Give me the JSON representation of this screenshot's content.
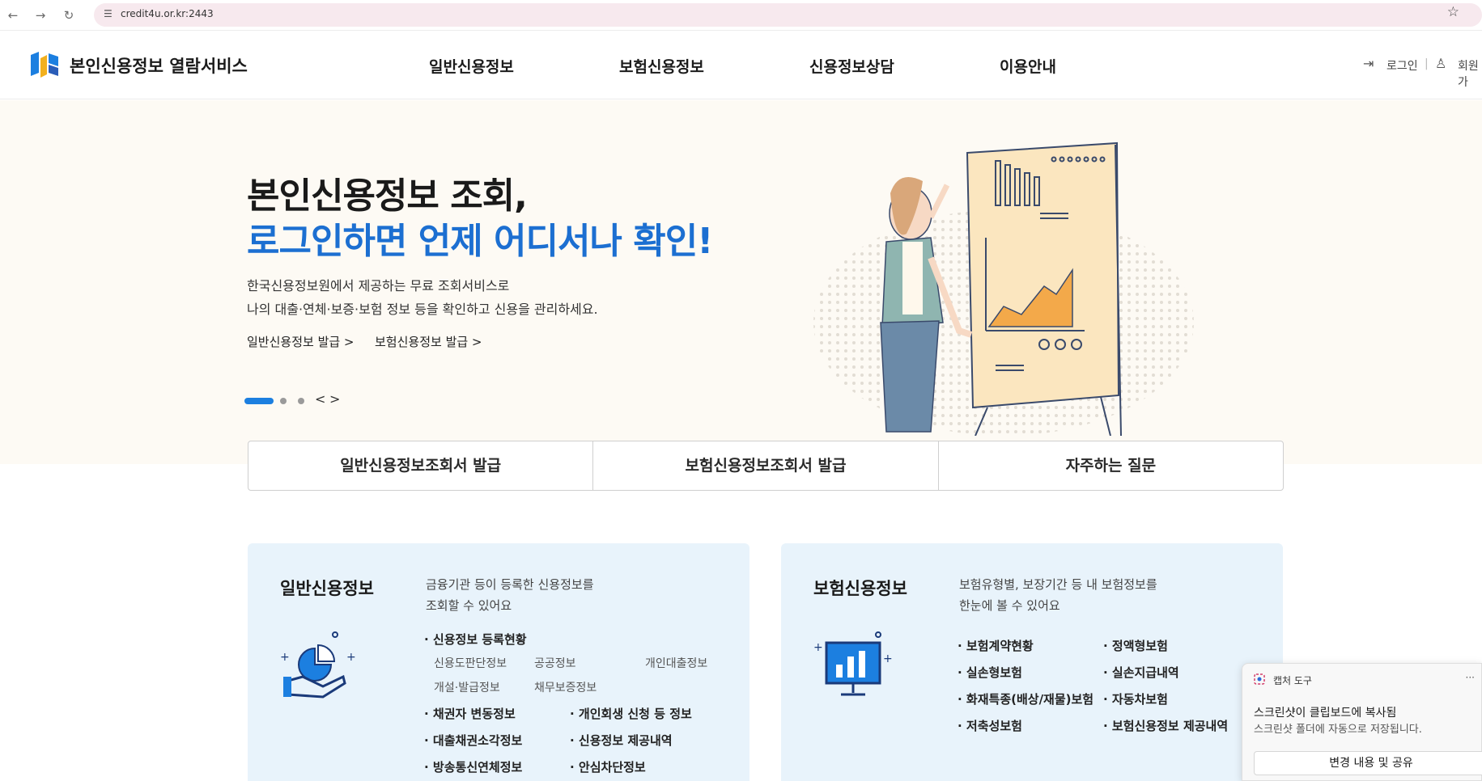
{
  "browser": {
    "url": "credit4u.or.kr:2443",
    "icons": {
      "back": "back-arrow-icon",
      "forward": "forward-arrow-icon",
      "reload": "reload-icon",
      "site_info": "tune-icon",
      "bookmark": "star-icon"
    }
  },
  "header": {
    "title": "본인신용정보 열람서비스",
    "nav": [
      "일반신용정보",
      "보험신용정보",
      "신용정보상담",
      "이용안내"
    ],
    "login": "로그인",
    "separator": "|",
    "signup": "회원가",
    "icons": {
      "login": "login-icon",
      "signup": "user-icon",
      "logo": "cis-logo"
    }
  },
  "hero": {
    "title_line1": "본인신용정보 조회,",
    "title_line2": "로그인하면 언제 어디서나 확인!",
    "desc_line1": "한국신용정보원에서 제공하는 무료 조회서비스로",
    "desc_line2": "나의 대출·연체·보증·보험 정보 등을 확인하고 신용을 관리하세요.",
    "links": [
      "일반신용정보 발급 >",
      "보험신용정보 발급 >"
    ],
    "slider": {
      "active_index": 0,
      "total": 3,
      "prev": "<",
      "next": ">"
    },
    "accent_color": "#1c6fd1"
  },
  "quick_menu": [
    "일반신용정보조회서 발급",
    "보험신용정보조회서 발급",
    "자주하는 질문"
  ],
  "cards": [
    {
      "title": "일반신용정보",
      "desc_line1": "금융기관 등이 등록한 신용정보를",
      "desc_line2": "조회할 수 있어요",
      "icon": "hand-pie-chart-icon",
      "group_title": "신용정보 등록현황",
      "sub_items": [
        "신용도판단정보",
        "공공정보",
        "개인대출정보",
        "개설·발급정보",
        "채무보증정보"
      ],
      "items": [
        "채권자 변동정보",
        "개인회생 신청 등 정보",
        "대출채권소각정보",
        "신용정보 제공내역",
        "방송통신연체정보",
        "안심차단정보"
      ]
    },
    {
      "title": "보험신용정보",
      "desc_line1": "보험유형별, 보장기간 등 내 보험정보를",
      "desc_line2": "한눈에 볼 수 있어요",
      "icon": "monitor-bar-chart-icon",
      "items": [
        "보험계약현황",
        "정액형보험",
        "실손형보험",
        "실손지급내역",
        "화재특종(배상/재물)보험",
        "자동차보험",
        "저축성보험",
        "보험신용정보 제공내역"
      ]
    }
  ],
  "toast": {
    "app": "캡처 도구",
    "more": "···",
    "message_line1": "스크린샷이 클립보드에 복사됨",
    "message_line2": "스크린샷 폴더에 자동으로 저장됩니다.",
    "button": "변경 내용 및 공유"
  }
}
